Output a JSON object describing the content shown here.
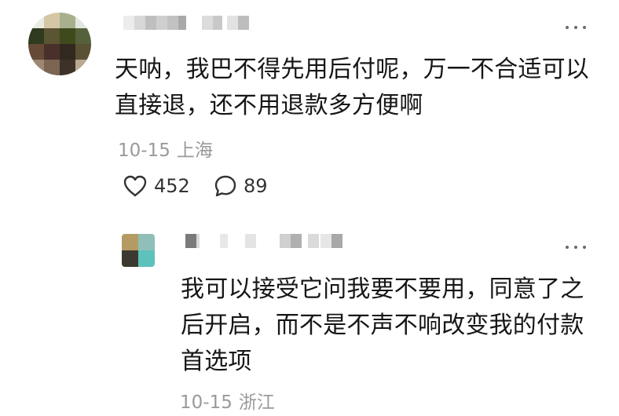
{
  "comment": {
    "text": "天呐，我巴不得先用后付呢，万一不合适可以直接退，还不用退款多方便啊",
    "date": "10-15",
    "location": "上海",
    "likes": "452",
    "replies": "89",
    "like_icon": "heart-outline-icon",
    "reply_icon": "speech-bubble-icon",
    "more_icon": "more-dots-icon"
  },
  "reply": {
    "text": "我可以接受它问我要不要用，同意了之后开启，而不是不声不响改变我的付款首选项",
    "date": "10-15",
    "location": "浙江",
    "more_icon": "more-dots-icon"
  },
  "colors": {
    "text": "#161616",
    "meta": "#9a9a9a",
    "icon": "#333333"
  }
}
